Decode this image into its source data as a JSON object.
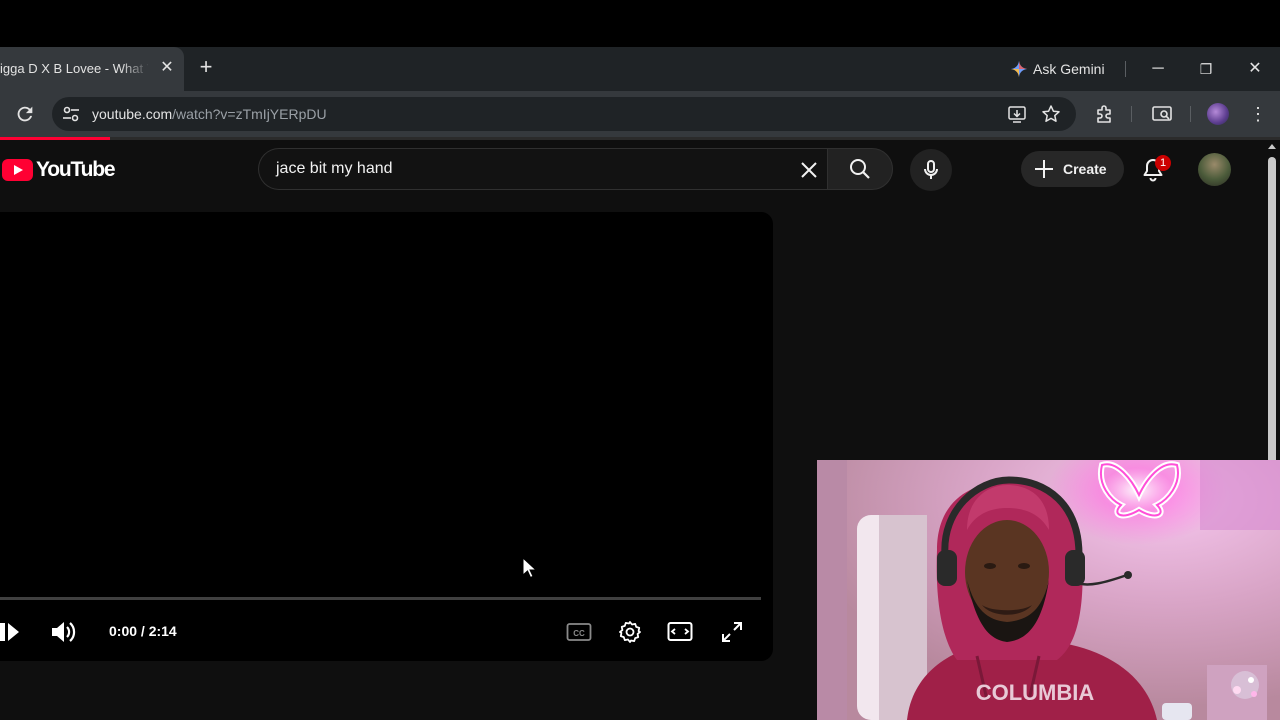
{
  "browser": {
    "tab_title": "igga D X B Lovee - What Y",
    "new_tab_label": "+",
    "gemini_label": "Ask Gemini",
    "url_main": "youtube.com",
    "url_path": "/watch?v=zTmIjYERpDU",
    "window_controls": {
      "minimize": "─",
      "restore": "❐",
      "close": "✕"
    }
  },
  "youtube": {
    "logo_text": "YouTube",
    "search_value": "jace bit my hand",
    "create_label": "Create",
    "notification_count": "1"
  },
  "player": {
    "time_display": "0:00 / 2:14",
    "progress": 0.0,
    "cc_label": "CC"
  },
  "webcam": {
    "shirt_text": "COLUMBIA"
  },
  "colors": {
    "accent_red": "#ff0033",
    "chrome_bg": "#1f2326",
    "yt_bg": "#0f0f0f",
    "webcam_pink": "#ff4fd8"
  },
  "icons": [
    "reload-icon",
    "tune-icon",
    "install-icon",
    "star-icon",
    "extensions-icon",
    "media-icon",
    "search-icon",
    "mic-icon",
    "bell-icon",
    "play-icon",
    "volume-icon",
    "cc-icon",
    "settings-icon",
    "theater-icon",
    "fullscreen-icon"
  ]
}
